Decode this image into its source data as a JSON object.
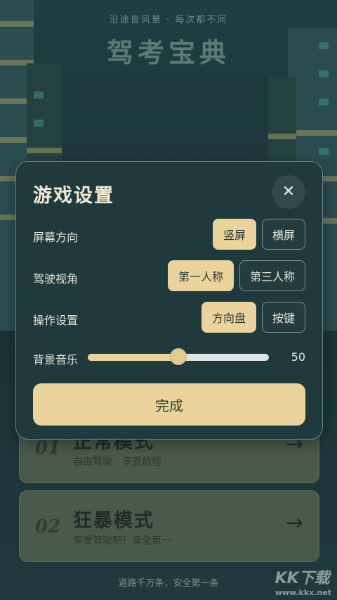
{
  "header": {
    "subtitle": "沿途皆风景 · 每次都不同",
    "title": "驾考宝典"
  },
  "modes": [
    {
      "num": "01",
      "title": "正常模式",
      "desc": "自由驾驶，享受旅程"
    },
    {
      "num": "02",
      "title": "狂暴模式",
      "desc": "享受驾驶吧！安全第一"
    }
  ],
  "footer": "道路千万条，安全第一条",
  "watermark": {
    "main": "KK下载",
    "url": "www.kkx.net"
  },
  "dialog": {
    "title": "游戏设置",
    "close_icon": "close-icon",
    "rows": {
      "screen": {
        "label": "屏幕方向",
        "options": [
          "竖屏",
          "横屏"
        ],
        "selected": "竖屏"
      },
      "view": {
        "label": "驾驶视角",
        "options": [
          "第一人称",
          "第三人称"
        ],
        "selected": "第一人称"
      },
      "control": {
        "label": "操作设置",
        "options": [
          "方向盘",
          "按键"
        ],
        "selected": "方向盘"
      },
      "music": {
        "label": "背景音乐",
        "value": 50,
        "value_text": "50",
        "max": 100
      }
    },
    "done_label": "完成"
  },
  "colors": {
    "accent": "#ebd49c",
    "dialog_bg": "#1f3a3c",
    "page_bg": "#1d3a3e"
  }
}
